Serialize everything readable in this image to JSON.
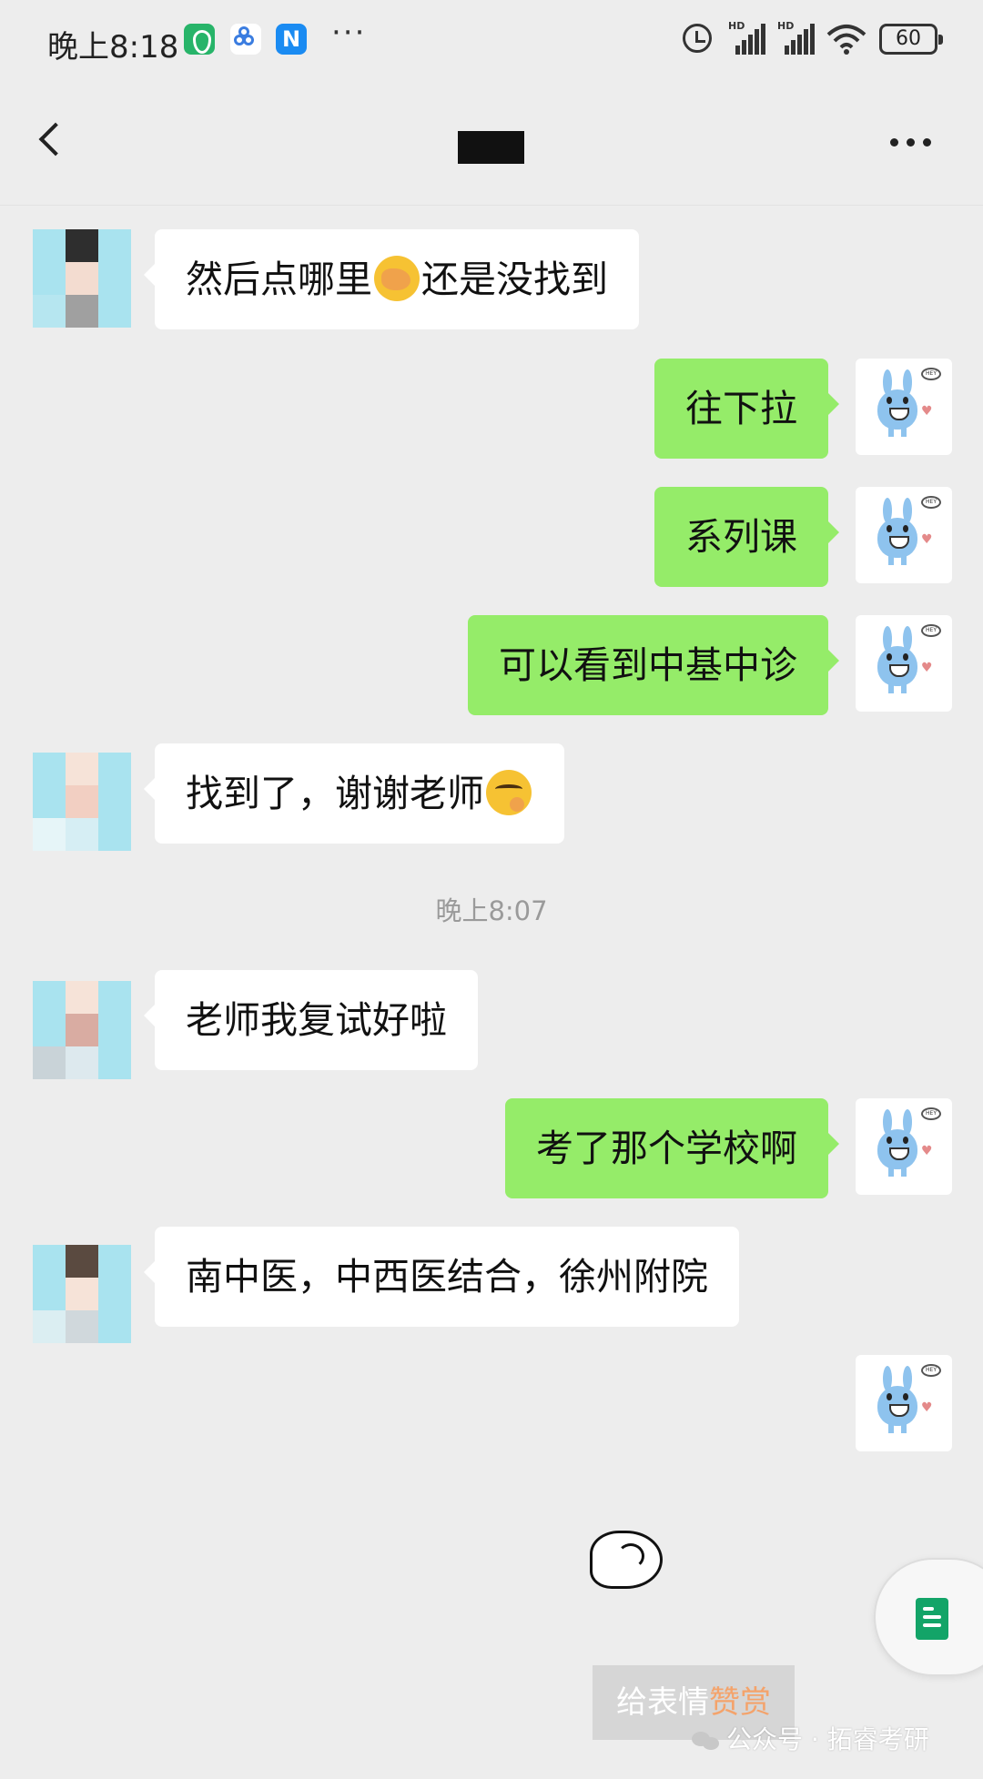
{
  "status_bar": {
    "time": "晚上8:18",
    "notification_icons": [
      "security-app-icon",
      "cloud-drive-icon",
      "n-app-icon"
    ],
    "overflow": "···",
    "signal_labels": [
      "HD",
      "HD"
    ],
    "battery": "60"
  },
  "header": {
    "title_redacted": "███",
    "back_icon": "chevron-left-icon",
    "more_icon": "more-dots-icon"
  },
  "messages": [
    {
      "side": "in",
      "parts": [
        "然后点哪里",
        "还是没找到"
      ],
      "emoji": "facepalm"
    },
    {
      "side": "out",
      "text": "往下拉"
    },
    {
      "side": "out",
      "text": "系列课"
    },
    {
      "side": "out",
      "text": "可以看到中基中诊"
    },
    {
      "side": "in",
      "parts": [
        "找到了，谢谢老师"
      ],
      "emoji": "smirk"
    },
    {
      "side": "in",
      "text": "老师我复试好啦"
    },
    {
      "side": "out",
      "text": "考了那个学校啊"
    },
    {
      "side": "in",
      "text": "南中医，中西医结合，徐州附院"
    }
  ],
  "time_divider": "晚上8:07",
  "footer": {
    "reward_prefix": "给表情",
    "reward_accent": "赞赏",
    "watermark": "公众号 · 拓睿考研"
  },
  "colors": {
    "background": "#ededed",
    "outgoing_bubble": "#95ec69",
    "incoming_bubble": "#ffffff",
    "accent_orange": "#f4a36b"
  }
}
